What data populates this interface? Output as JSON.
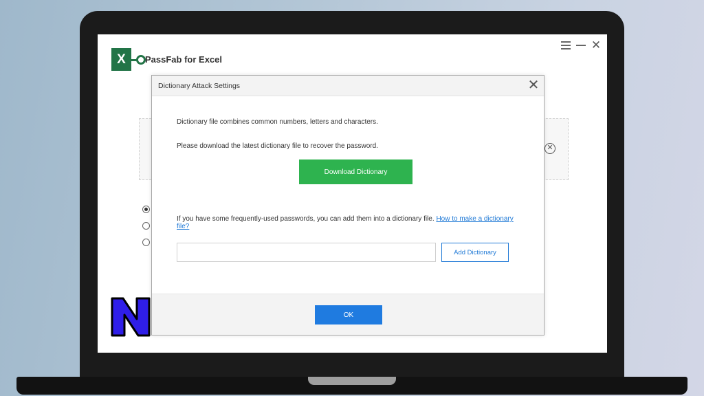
{
  "app": {
    "title": "PassFab for Excel",
    "logo_letter": "X"
  },
  "window_controls": {
    "menu_icon": "hamburger-menu-icon",
    "minimize_icon": "minimize-icon",
    "close_symbol": "✕"
  },
  "dialog": {
    "title": "Dictionary Attack Settings",
    "close_symbol": "✕",
    "line1": "Dictionary file combines common numbers, letters and characters.",
    "line2": "Please download the latest dictionary file to recover the password.",
    "download_button": "Download Dictionary",
    "info_text": "If you have some frequently-used passwords, you can add them into a dictionary file.",
    "info_link": "How to make a dictionary file?",
    "dictionary_input_value": "",
    "add_button": "Add Dictionary",
    "ok_button": "OK"
  },
  "background": {
    "close_circle_symbol": "✕",
    "radio_options": [
      {
        "checked": true
      },
      {
        "checked": false
      },
      {
        "checked": false
      }
    ]
  },
  "colors": {
    "excel_green": "#227447",
    "download_green": "#2eb34f",
    "primary_blue": "#1f7be0",
    "link_blue": "#1f79d6",
    "watermark_purple": "#2f1ee8"
  }
}
